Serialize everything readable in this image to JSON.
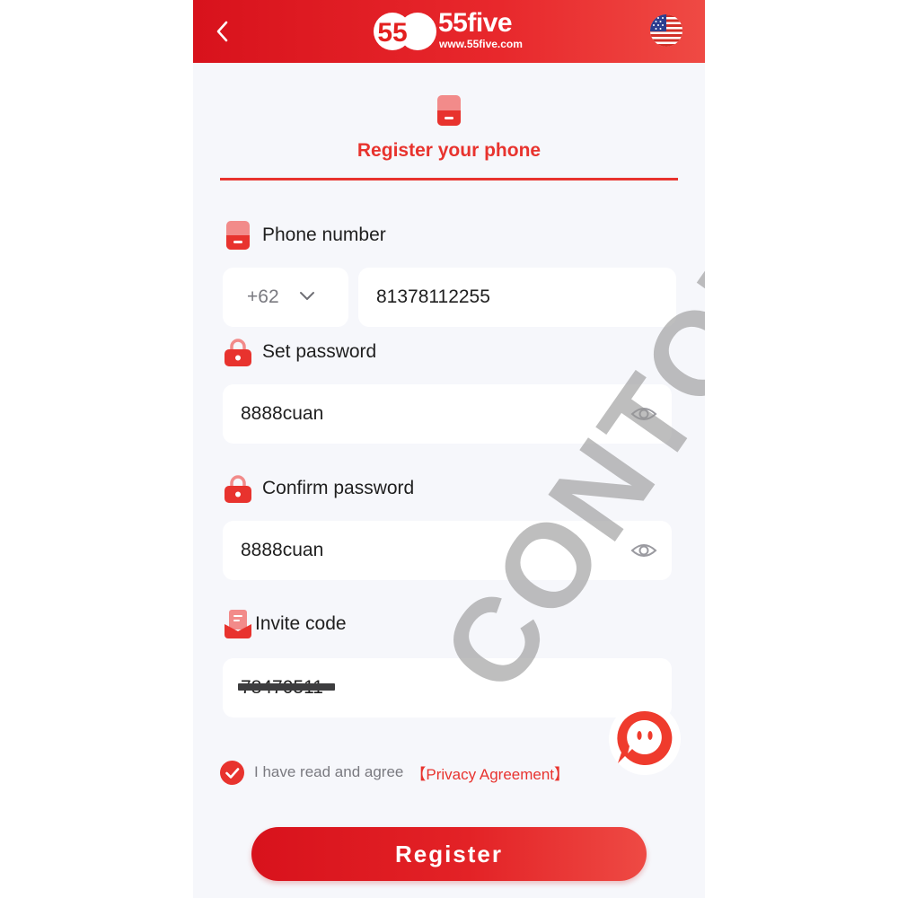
{
  "header": {
    "logo_text": "55five",
    "logo_badge": "55",
    "logo_url": "www.55five.com",
    "language_flag_icon": "us-flag-icon",
    "back_icon": "chevron-left-icon"
  },
  "tab": {
    "title": "Register your phone",
    "icon": "phone-icon"
  },
  "form": {
    "phone_label": "Phone number",
    "country_code": "+62",
    "phone_value": "81378112255",
    "password_label": "Set password",
    "password_value": "8888cuan",
    "confirm_label": "Confirm password",
    "confirm_value": "8888cuan",
    "invite_label": "Invite code",
    "invite_value": "78470511"
  },
  "agreement": {
    "text": "I have read and agree",
    "link": "【Privacy Agreement】",
    "checked": true
  },
  "register_button": "Register",
  "watermark": "CONTOH",
  "colors": {
    "brand_red": "#e8332e",
    "header_red": "#d8121c",
    "background": "#f6f7fb"
  }
}
